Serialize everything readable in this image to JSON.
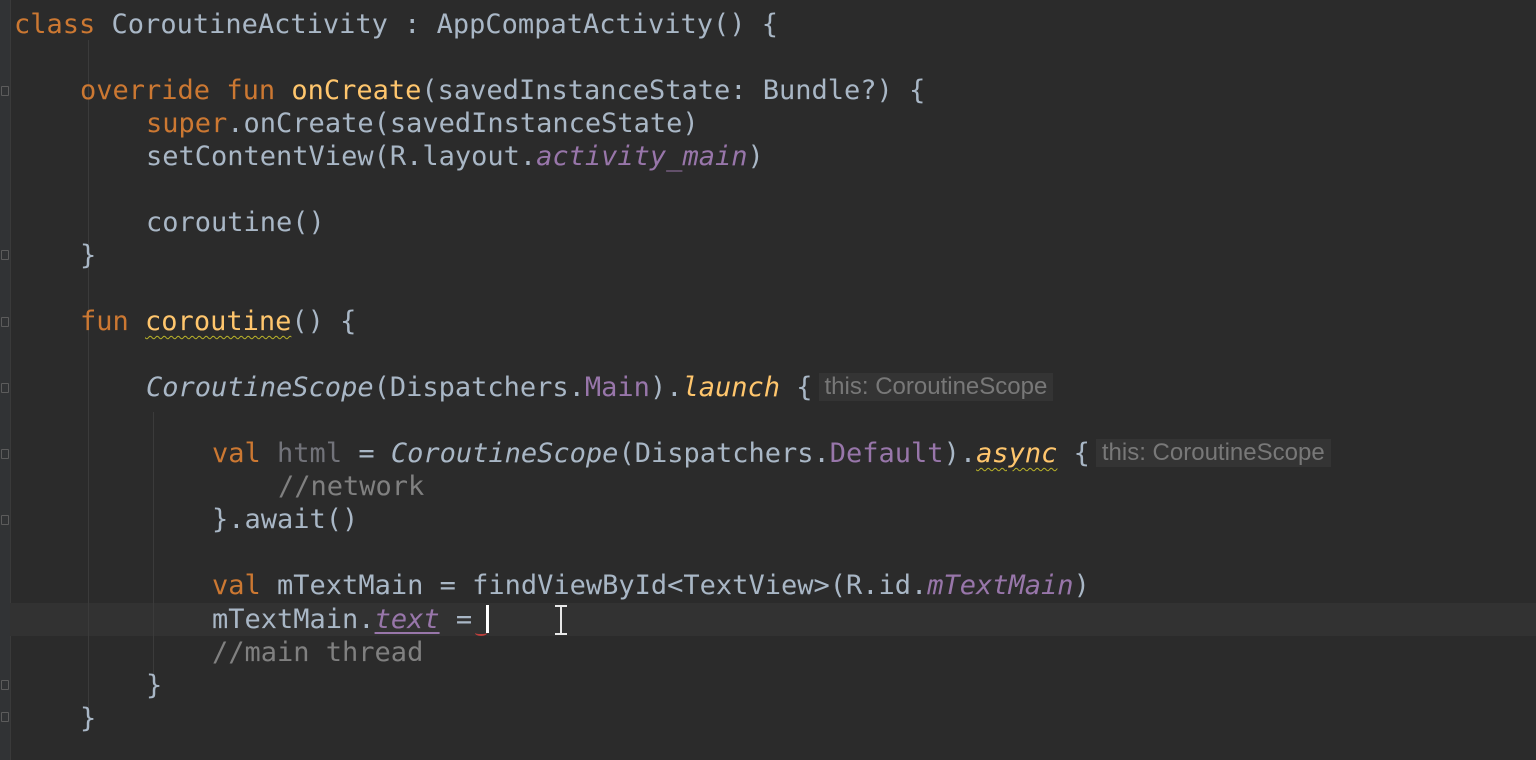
{
  "editor": {
    "l1": {
      "kw_class": "class",
      "name": "CoroutineActivity",
      "rest": " : AppCompatActivity() {"
    },
    "l2": {
      "kw_override": "override",
      "kw_fun": "fun",
      "fn": "onCreate",
      "rest": "(savedInstanceState: Bundle?) {"
    },
    "l3": {
      "kw_super": "super",
      "rest": ".onCreate(savedInstanceState)"
    },
    "l4": {
      "pre": "setContentView(R.layout.",
      "prop": "activity_main",
      "post": ")"
    },
    "l5": {
      "text": "coroutine()"
    },
    "l6": {
      "text": "}"
    },
    "l7": {
      "kw_fun": "fun",
      "fn": "coroutine",
      "rest": "() {"
    },
    "l8": {
      "scope": "CoroutineScope",
      "mid": "(Dispatchers.",
      "member": "Main",
      "close": ").",
      "launch": "launch",
      "brace": " {",
      "hint": "this: CoroutineScope"
    },
    "l9": {
      "kw_val": "val",
      "var": "html",
      "eq": " = ",
      "scope": "CoroutineScope",
      "mid": "(Dispatchers.",
      "member": "Default",
      "close": ").",
      "async": "async",
      "brace": " {",
      "hint": "this: CoroutineScope"
    },
    "l10": {
      "comment": "//network"
    },
    "l11": {
      "text": "}.await()"
    },
    "l12": {
      "kw_val": "val",
      "pre": " mTextMain = findViewById<TextView>(R.id.",
      "prop": "mTextMain",
      "post": ")"
    },
    "l13": {
      "pre": "mTextMain.",
      "prop": "text",
      "post": " ="
    },
    "l14": {
      "comment": "//main thread"
    },
    "l15": {
      "text": "}"
    },
    "l16": {
      "text": "}"
    }
  },
  "colors": {
    "background": "#2b2b2b",
    "keyword": "#cc7832",
    "function": "#ffc66d",
    "property": "#9876aa",
    "comment": "#808080",
    "default_text": "#a9b7c6"
  }
}
